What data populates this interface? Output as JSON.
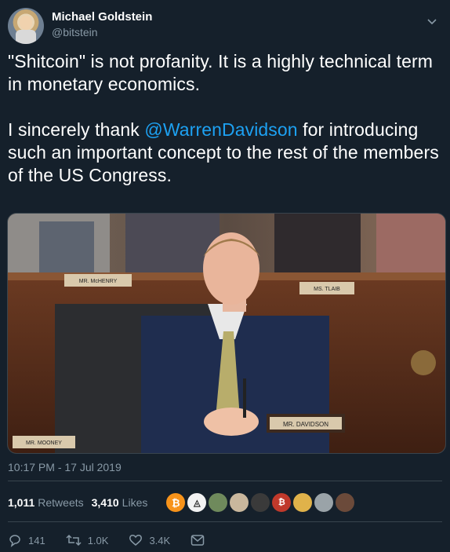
{
  "author": {
    "name": "Michael Goldstein",
    "handle": "@bitstein"
  },
  "tweet": {
    "line1": "\"Shitcoin\" is not profanity. It is a highly technical term in monetary economics.",
    "line2_before": "I sincerely thank ",
    "mention": "@WarrenDavidson",
    "line2_after": " for introducing such an important concept to the rest of the members of the US Congress."
  },
  "media": {
    "nameplate_davidson": "MR. DAVIDSON",
    "nameplate_mchenry": "MR. McHENRY",
    "nameplate_tlaib": "MS. TLAIB",
    "nameplate_mooney": "MR. MOONEY"
  },
  "timestamp": "10:17 PM - 17 Jul 2019",
  "stats": {
    "retweets_count": "1,011",
    "retweets_label": "Retweets",
    "likes_count": "3,410",
    "likes_label": "Likes"
  },
  "actions": {
    "replies": "141",
    "retweets": "1.0K",
    "likes": "3.4K"
  },
  "colors": {
    "background": "#15202b",
    "accent": "#1da1f2",
    "muted": "#8899a6",
    "border": "#38444d"
  }
}
